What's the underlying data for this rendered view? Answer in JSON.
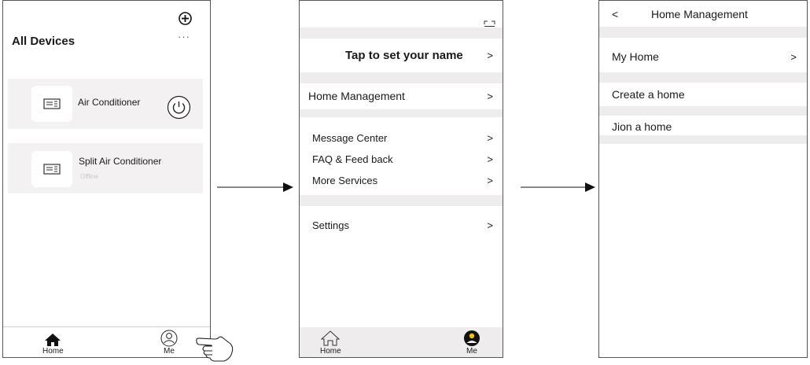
{
  "screen1": {
    "title": "All Devices",
    "add_icon": "plus-circle-icon",
    "more_icon": "ellipsis-icon",
    "devices": [
      {
        "name": "Air Conditioner",
        "status": "",
        "icon": "air-conditioner-icon",
        "power_icon": "power-icon"
      },
      {
        "name": "Split Air Conditioner",
        "status": "Offline",
        "icon": "air-conditioner-icon"
      }
    ],
    "tabs": [
      {
        "label": "Home",
        "icon": "home-icon"
      },
      {
        "label": "Me",
        "icon": "user-icon"
      }
    ],
    "hand_icon": "pointing-hand-icon"
  },
  "screen2": {
    "scan_icon": "scan-icon",
    "name_prompt": "Tap to set your name",
    "home_management": "Home Management",
    "items": [
      "Message Center",
      "FAQ & Feed back",
      "More Services"
    ],
    "settings": "Settings",
    "chevron": ">",
    "tabs": [
      {
        "label": "Home",
        "icon": "home-outline-icon"
      },
      {
        "label": "Me",
        "icon": "user-filled-icon"
      }
    ]
  },
  "screen3": {
    "back": "<",
    "title": "Home Management",
    "my_home": "My Home",
    "chevron": ">",
    "create": "Create a home",
    "join": "Jion a home"
  },
  "colors": {
    "band": "#eeecec",
    "card": "#f3f1f1",
    "border": "#555555"
  }
}
